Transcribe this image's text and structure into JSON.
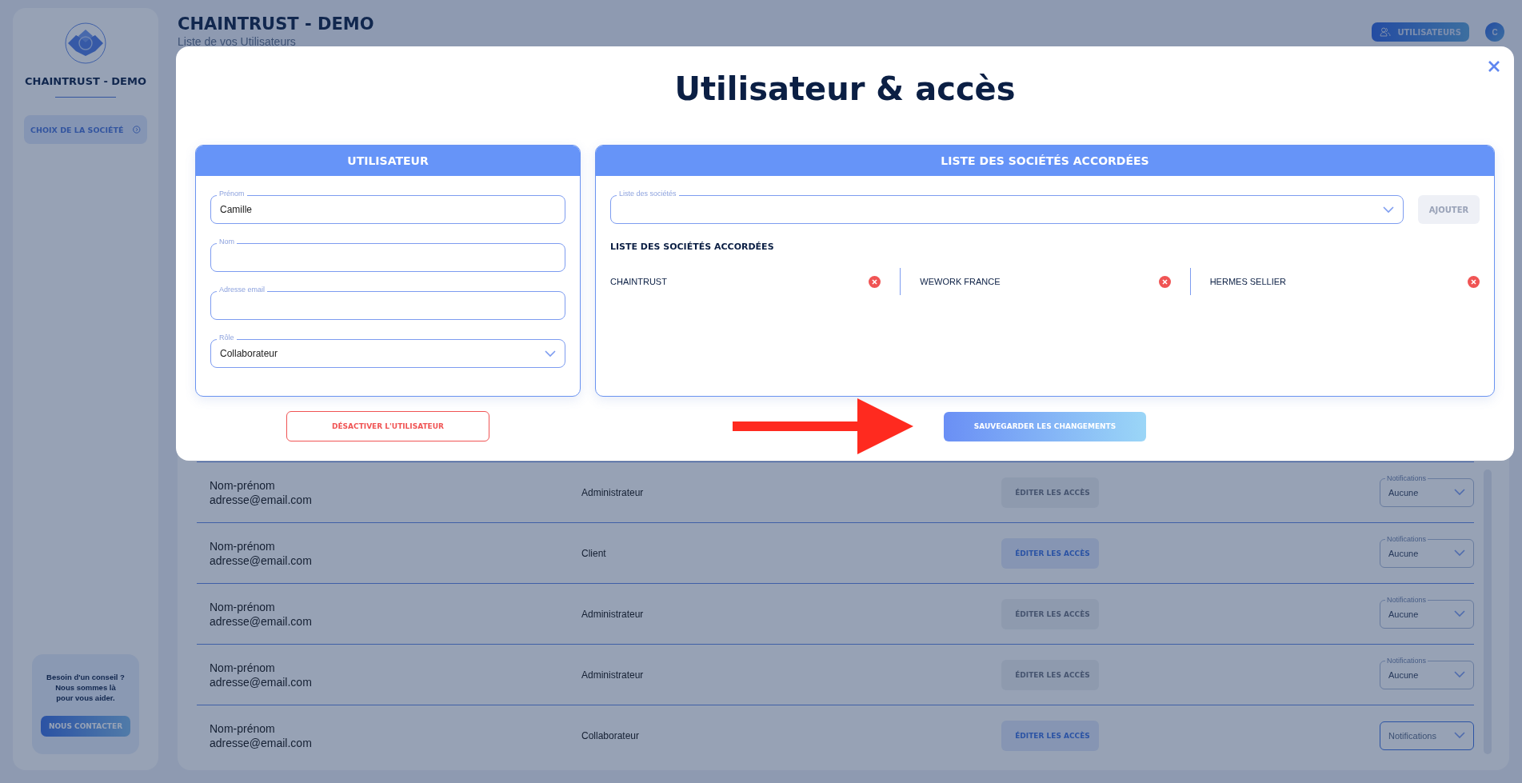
{
  "sidebar": {
    "brand": "CHAINTRUST - DEMO",
    "nav_button": "CHOIX DE LA SOCIÉTÉ",
    "help": {
      "lines": [
        "Besoin d'un conseil ?",
        "Nous sommes là",
        "pour vous aider."
      ],
      "button": "NOUS CONTACTER"
    }
  },
  "header": {
    "title": "CHAINTRUST - DEMO",
    "subtitle": "Liste de vos Utilisateurs",
    "users_button": "UTILISATEURS",
    "avatar": "C"
  },
  "table": {
    "rows": [
      {
        "name": "Nom-prénom",
        "email": "adresse@email.com",
        "role": "Administrateur",
        "edit_button": {
          "label": "ÉDITER LES ACCÈS",
          "disabled": true
        },
        "notifications": {
          "label": "Notifications",
          "value": "Aucune"
        }
      },
      {
        "name": "Nom-prénom",
        "email": "adresse@email.com",
        "role": "Client",
        "edit_button": {
          "label": "ÉDITER LES ACCÈS",
          "disabled": false
        },
        "notifications": {
          "label": "Notifications",
          "value": "Aucune"
        }
      },
      {
        "name": "Nom-prénom",
        "email": "adresse@email.com",
        "role": "Administrateur",
        "edit_button": {
          "label": "ÉDITER LES ACCÈS",
          "disabled": true
        },
        "notifications": {
          "label": "Notifications",
          "value": "Aucune"
        }
      },
      {
        "name": "Nom-prénom",
        "email": "adresse@email.com",
        "role": "Administrateur",
        "edit_button": {
          "label": "ÉDITER LES ACCÈS",
          "disabled": true
        },
        "notifications": {
          "label": "Notifications",
          "value": "Aucune"
        }
      },
      {
        "name": "Nom-prénom",
        "email": "adresse@email.com",
        "role": "Collaborateur",
        "edit_button": {
          "label": "ÉDITER LES ACCÈS",
          "disabled": false
        },
        "notifications": {
          "placeholder": "Notifications"
        }
      }
    ]
  },
  "modal": {
    "title": "Utilisateur & accès",
    "user_card": {
      "heading": "UTILISATEUR",
      "fields": [
        {
          "kind": "text",
          "label": "Prénom",
          "value": "Camille"
        },
        {
          "kind": "text",
          "label": "Nom"
        },
        {
          "kind": "text",
          "label": "Adresse email"
        },
        {
          "kind": "select",
          "label": "Rôle",
          "value": "Collaborateur"
        }
      ]
    },
    "companies_card": {
      "heading": "LISTE DES SOCIÉTÉS ACCORDÉES",
      "picker": {
        "label": "Liste des sociétés"
      },
      "add_button": {
        "label": "AJOUTER",
        "disabled": true
      },
      "list_heading": "LISTE DES SOCIÉTÉS ACCORDÉES",
      "companies": [
        "CHAINTRUST",
        "WEWORK FRANCE",
        "HERMES SELLIER"
      ]
    },
    "deactivate_button": "DÉSACTIVER L'UTILISATEUR",
    "save_button": "SAUVEGARDER LES CHANGEMENTS"
  }
}
